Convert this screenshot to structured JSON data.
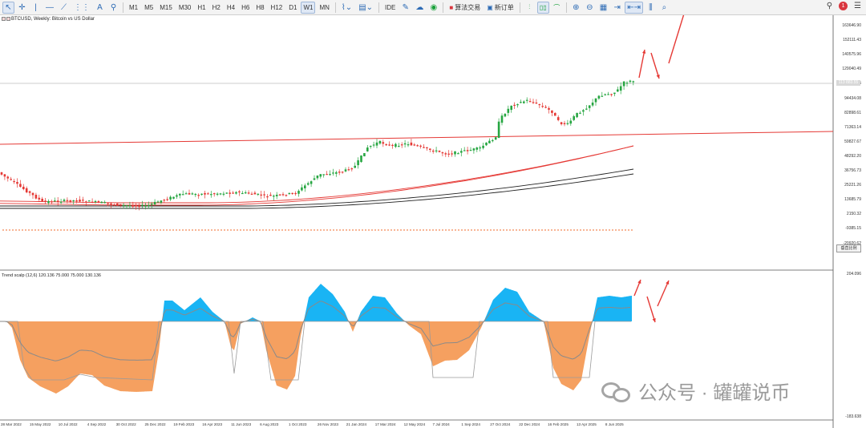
{
  "toolbar": {
    "buttons": [
      "↖",
      "✛",
      "|",
      "—",
      "⟋",
      "⋮⋮",
      "A",
      "⚲"
    ],
    "timeframes": [
      "M1",
      "M5",
      "M15",
      "M30",
      "H1",
      "H2",
      "H4",
      "H6",
      "H8",
      "H12",
      "D1",
      "W1",
      "MN"
    ],
    "active_timeframe": "W1",
    "ide_label": "IDE",
    "algo_trading_label": "算法交易",
    "new_order_label": "新订单",
    "notification_count": "1"
  },
  "chart": {
    "title": "BTCUSD, Weekly:  Bitcoin vs US Dollar",
    "current_price": "113 883.55",
    "scale_button": "垂直比例",
    "price_labels": [
      "163646.90",
      "152111.43",
      "140575.96",
      "129040.49",
      "105969.55",
      "94434.08",
      "82898.61",
      "71363.14",
      "59827.67",
      "48292.20",
      "36756.73",
      "25221.26",
      "13685.79",
      "2150.32",
      "-9385.15",
      "-20920.62"
    ],
    "time_labels": [
      "28 Mar 2022",
      "15 May 2022",
      "10 Jul 2022",
      "4 Sep 2022",
      "30 Oct 2022",
      "25 Dec 2022",
      "19 Feb 2023",
      "16 Apr 2023",
      "11 Jun 2023",
      "6 Aug 2023",
      "1 Oct 2023",
      "26 Nov 2023",
      "21 Jan 2024",
      "17 Mar 2024",
      "12 May 2024",
      "7 Jul 2024",
      "1 Sep 2024",
      "27 Oct 2024",
      "22 Dec 2024",
      "16 Feb 2025",
      "13 Apr 2025",
      "8 Jun 2025"
    ],
    "colors": {
      "bull": "#26a641",
      "bear": "#e53935",
      "trendline": "#e53935",
      "ma_black": "#222222",
      "arrows": "#e53935"
    }
  },
  "indicator": {
    "title": "Trend scalp (12,6) 120.136 75.000 75.000 130.136",
    "top_label": "204.096",
    "bottom_label": "-183.638",
    "colors": {
      "positive_fill": "#19b4f4",
      "negative_fill": "#f5a060",
      "line": "#888888"
    }
  },
  "watermark": {
    "text": "公众号 · 罐罐说币"
  }
}
